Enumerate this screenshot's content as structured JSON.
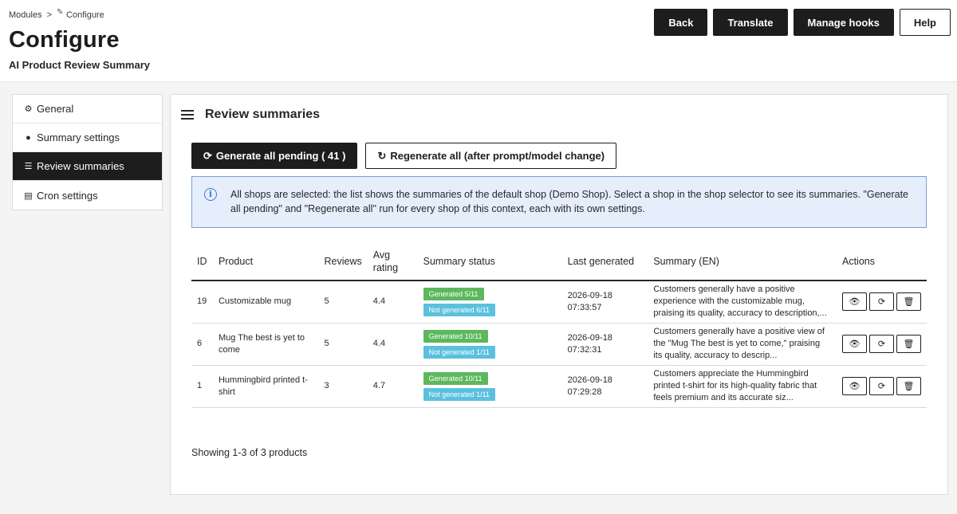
{
  "breadcrumb": {
    "parent": "Modules",
    "separator": ">",
    "current": "Configure"
  },
  "header": {
    "title": "Configure",
    "subtitle": "AI Product Review Summary",
    "buttons": {
      "back": "Back",
      "translate": "Translate",
      "manage_hooks": "Manage hooks",
      "help": "Help"
    }
  },
  "sidebar": {
    "items": [
      {
        "label": "General",
        "icon": "gears-icon"
      },
      {
        "label": "Summary settings",
        "icon": "comment-icon"
      },
      {
        "label": "Review summaries",
        "icon": "list-icon",
        "active": true
      },
      {
        "label": "Cron settings",
        "icon": "file-icon"
      }
    ]
  },
  "main": {
    "title": "Review summaries",
    "generate_pending_label": "Generate all pending ( 41 )",
    "regenerate_all_label": "Regenerate all (after prompt/model change)",
    "alert": "All shops are selected: the list shows the summaries of the default shop (Demo Shop). Select a shop in the shop selector to see its summaries. \"Generate all pending\" and \"Regenerate all\" run for every shop of this context, each with its own settings.",
    "table": {
      "headers": {
        "id": "ID",
        "product": "Product",
        "reviews": "Reviews",
        "avg_rating": "Avg rating",
        "status": "Summary status",
        "last_generated": "Last generated",
        "summary": "Summary (EN)",
        "actions": "Actions"
      },
      "rows": [
        {
          "id": "19",
          "product": "Customizable mug",
          "reviews": "5",
          "rating": "4.4",
          "generated": "Generated 5/11",
          "not_generated": "Not generated 6/11",
          "date": "2026-09-18",
          "time": "07:33:57",
          "summary": "Customers generally have a positive experience with the customizable mug, praising its quality, accuracy to description,..."
        },
        {
          "id": "6",
          "product": "Mug The best is yet to come",
          "reviews": "5",
          "rating": "4.4",
          "generated": "Generated 10/11",
          "not_generated": "Not generated 1/11",
          "date": "2026-09-18",
          "time": "07:32:31",
          "summary": "Customers generally have a positive view of the \"Mug The best is yet to come,\" praising its quality, accuracy to descrip..."
        },
        {
          "id": "1",
          "product": "Hummingbird printed t-shirt",
          "reviews": "3",
          "rating": "4.7",
          "generated": "Generated 10/11",
          "not_generated": "Not generated 1/11",
          "date": "2026-09-18",
          "time": "07:29:28",
          "summary": "Customers appreciate the Hummingbird printed t-shirt for its high-quality fabric that feels premium and its accurate siz..."
        }
      ]
    },
    "showing": "Showing 1-3 of 3 products"
  }
}
